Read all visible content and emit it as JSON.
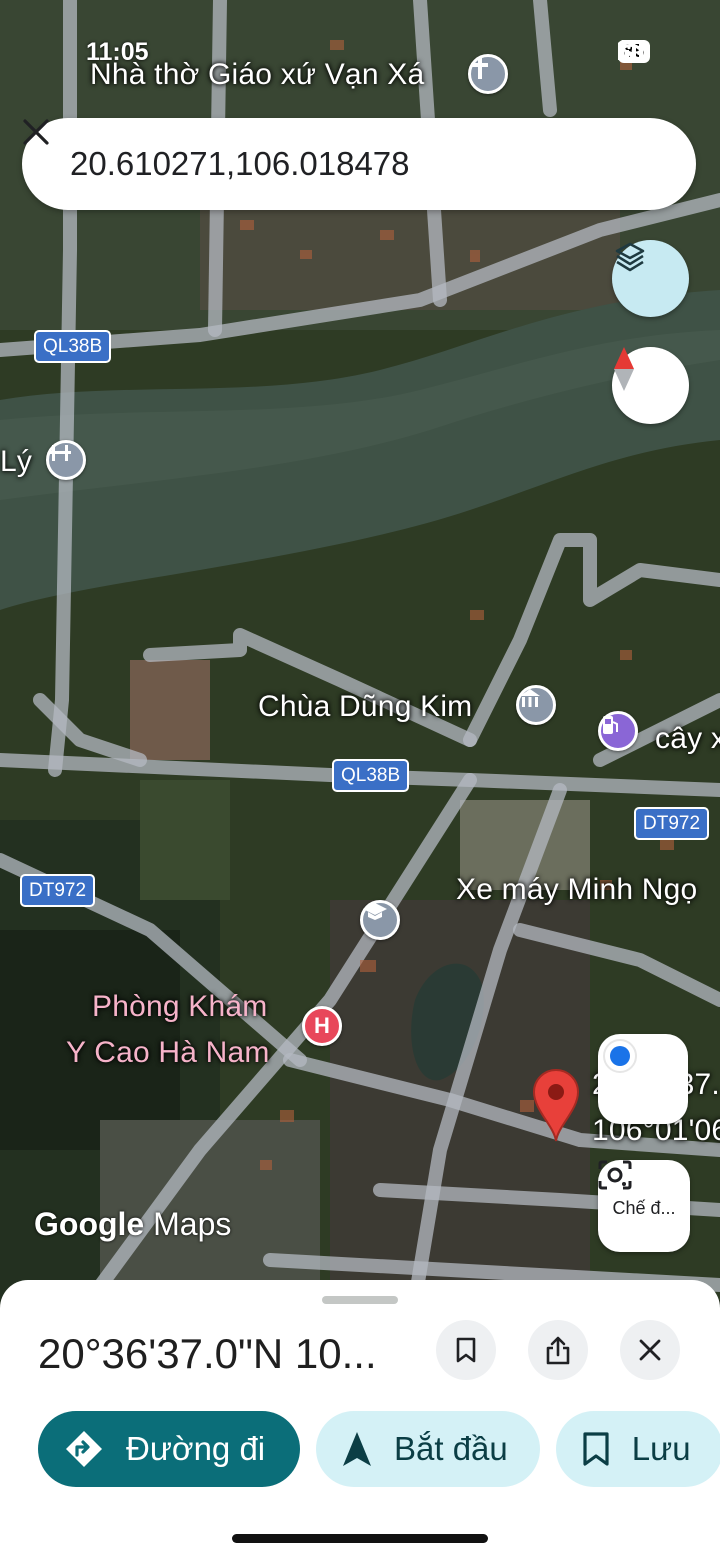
{
  "status_bar": {
    "time": "11:05",
    "battery": "85"
  },
  "search": {
    "query": "20.610271,106.018478"
  },
  "map": {
    "labels": {
      "church": "Nhà thờ Giáo xứ Vạn Xá",
      "ly_partial": "Lý",
      "pagoda": "Chùa Dũng Kim",
      "fuel_partial": "cây x",
      "motorbike": "Xe máy Minh Ngọ",
      "clinic_line1": "Phòng Khám",
      "clinic_line2": "Y Cao Hà Nam",
      "pin_coord_line1": "20°36'37.",
      "pin_coord_line2": "106°01'06"
    },
    "road_shields": {
      "ql38b_top": "QL38B",
      "ql38b_mid": "QL38B",
      "dt972_left": "DT972",
      "dt972_right": "DT972"
    },
    "lens_label": "Chế đ...",
    "logo_google": "Google",
    "logo_maps": "Maps"
  },
  "sheet": {
    "title": "20°36'37.0\"N 10...",
    "actions": [
      {
        "label": "Đường đi"
      },
      {
        "label": "Bắt đầu"
      },
      {
        "label": "Lưu"
      }
    ]
  },
  "colors": {
    "accent": "#0b6e79",
    "tonal": "#d4f1f6",
    "pin": "#e8403a"
  }
}
